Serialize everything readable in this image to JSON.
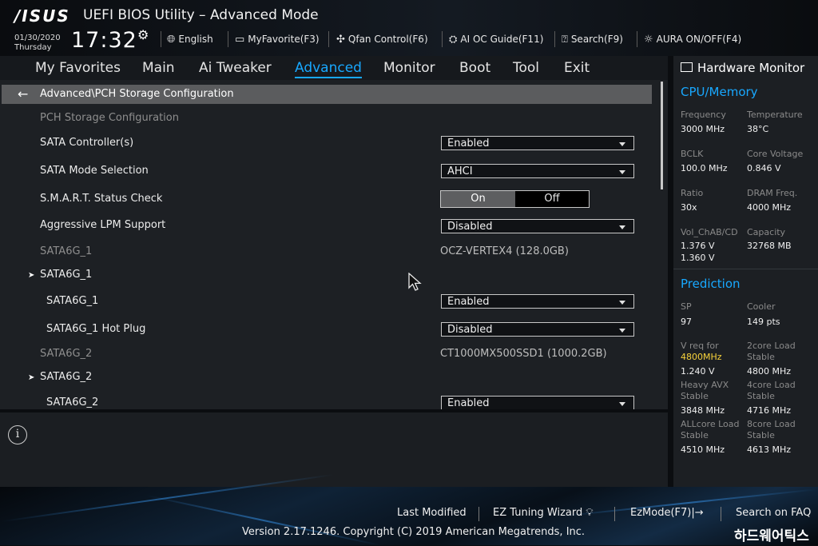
{
  "header": {
    "logo": "/ISUS",
    "title": "UEFI BIOS Utility – Advanced Mode",
    "date": "01/30/2020",
    "weekday": "Thursday",
    "time": "17:32",
    "tools": [
      {
        "label": "English",
        "icon": "globe-icon"
      },
      {
        "label": "MyFavorite(F3)",
        "icon": "favorite-icon"
      },
      {
        "label": "Qfan Control(F6)",
        "icon": "fan-icon"
      },
      {
        "label": "AI OC Guide(F11)",
        "icon": "chip-icon"
      },
      {
        "label": "Search(F9)",
        "icon": "search-icon"
      },
      {
        "label": "AURA ON/OFF(F4)",
        "icon": "aura-icon"
      }
    ]
  },
  "nav": {
    "tabs": [
      "My Favorites",
      "Main",
      "Ai Tweaker",
      "Advanced",
      "Monitor",
      "Boot",
      "Tool",
      "Exit"
    ],
    "active": "Advanced"
  },
  "breadcrumb": "Advanced\\PCH Storage Configuration",
  "settings": {
    "section_title": "PCH Storage Configuration",
    "sata_controller": {
      "label": "SATA Controller(s)",
      "value": "Enabled"
    },
    "sata_mode": {
      "label": "SATA Mode Selection",
      "value": "AHCI"
    },
    "smart": {
      "label": "S.M.A.R.T. Status Check",
      "on": "On",
      "off": "Off",
      "selected": "On"
    },
    "lpm": {
      "label": "Aggressive LPM Support",
      "value": "Disabled"
    },
    "port1_info": {
      "label": "SATA6G_1",
      "value": "OCZ-VERTEX4 (128.0GB)"
    },
    "port1_group": "SATA6G_1",
    "port1_enable": {
      "label": "SATA6G_1",
      "value": "Enabled"
    },
    "port1_hotplug": {
      "label": "SATA6G_1 Hot Plug",
      "value": "Disabled"
    },
    "port2_info": {
      "label": "SATA6G_2",
      "value": "CT1000MX500SSD1 (1000.2GB)"
    },
    "port2_group": "SATA6G_2",
    "port2_enable": {
      "label": "SATA6G_2",
      "value": "Enabled"
    }
  },
  "hardware_monitor": {
    "title": "Hardware Monitor",
    "cpu_memory": {
      "title": "CPU/Memory",
      "frequency": {
        "label": "Frequency",
        "value": "3000 MHz"
      },
      "temperature": {
        "label": "Temperature",
        "value": "38°C"
      },
      "bclk": {
        "label": "BCLK",
        "value": "100.0 MHz"
      },
      "core_voltage": {
        "label": "Core Voltage",
        "value": "0.846 V"
      },
      "ratio": {
        "label": "Ratio",
        "value": "30x"
      },
      "dram_freq": {
        "label": "DRAM Freq.",
        "value": "4000 MHz"
      },
      "vol_chab": {
        "label": "Vol_ChAB/CD",
        "value1": "1.376 V",
        "value2": "1.360 V"
      },
      "capacity": {
        "label": "Capacity",
        "value": "32768 MB"
      }
    },
    "prediction": {
      "title": "Prediction",
      "sp": {
        "label": "SP",
        "value": "97"
      },
      "cooler": {
        "label": "Cooler",
        "value": "149 pts"
      },
      "vreq": {
        "label": "V req for",
        "freq": "4800MHz",
        "value": "1.240 V"
      },
      "two_core": {
        "label1": "2core Load",
        "label2": "Stable",
        "value": "4800 MHz"
      },
      "heavy_avx": {
        "label1": "Heavy AVX",
        "label2": "Stable",
        "value": "3848 MHz"
      },
      "four_core": {
        "label1": "4core Load",
        "label2": "Stable",
        "value": "4716 MHz"
      },
      "all_core": {
        "label1": "ALLcore Load",
        "label2": "Stable",
        "value": "4510 MHz"
      },
      "eight_core": {
        "label1": "8core Load",
        "label2": "Stable",
        "value": "4613 MHz"
      }
    }
  },
  "info_icon": "i",
  "footer": {
    "last_modified": "Last Modified",
    "ez_tuning": "EZ Tuning Wizard",
    "ez_mode": "EzMode(F7)|→",
    "search_faq": "Search on FAQ",
    "version": "Version 2.17.1246. Copyright (C) 2019 American Megatrends, Inc.",
    "watermark": "하드웨어틱스"
  }
}
